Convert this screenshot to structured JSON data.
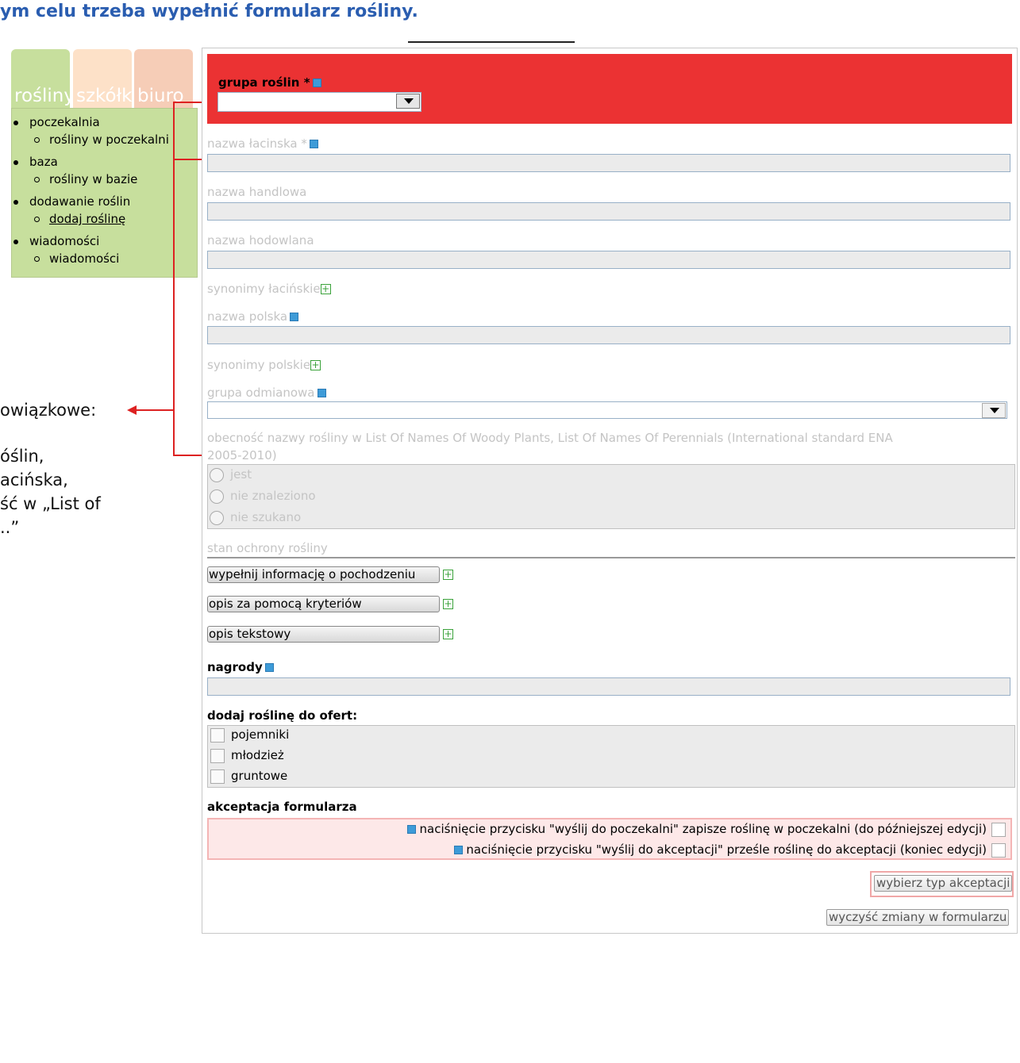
{
  "heading": "ym celu trzeba wypełnić formularz rośliny.",
  "tabs": [
    "rośliny",
    "szkółki",
    "biuro"
  ],
  "menu": [
    {
      "label": "poczekalnia",
      "sub": "rośliny w poczekalni"
    },
    {
      "label": "baza",
      "sub": "rośliny w bazie"
    },
    {
      "label": "dodawanie roślin",
      "sub": "dodaj roślinę"
    },
    {
      "label": "wiadomości",
      "sub": "wiadomości"
    }
  ],
  "annotation": {
    "line1": "owiązkowe:",
    "line2": "óślin,",
    "line3": "acińska,",
    "line4": "ść w „List of",
    "line5": "..”"
  },
  "form": {
    "grupa_roslin": "grupa roślin",
    "required_mark": "*",
    "nazwa_lacinska": "nazwa łacinska",
    "nazwa_handlowa": "nazwa handlowa",
    "nazwa_hodowlana": "nazwa hodowlana",
    "synonimy_lacinskie": "synonimy łacińskie",
    "nazwa_polska": "nazwa polska",
    "synonimy_polskie": "synonimy polskie",
    "grupa_odmianowa": "grupa odmianowa",
    "obecnosc_line1": "obecność nazwy rośliny w List Of Names Of Woody Plants, List Of Names Of Perennials (International standard ENA",
    "obecnosc_line2": "2005-2010)",
    "radio_options": [
      "jest",
      "nie znaleziono",
      "nie szukano"
    ],
    "stan_ochrony": "stan ochrony rośliny",
    "btn_pochodzenie": "wypełnij informację o pochodzeniu",
    "btn_kryteria": "opis za pomocą kryteriów",
    "btn_tekstowy": "opis tekstowy",
    "nagrody": "nagrody",
    "oferty_title": "dodaj roślinę do ofert:",
    "oferty_options": [
      "pojemniki",
      "młodzież",
      "gruntowe"
    ],
    "akceptacja_title": "akceptacja formularza",
    "akceptacja_1": "naciśnięcie przycisku \"wyślij do poczekalni\" zapisze roślinę w poczekalni (do późniejszej edycji)",
    "akceptacja_2": "naciśnięcie przycisku \"wyślij do akceptacji\" prześle roślinę do akceptacji (koniec edycji)",
    "btn_wybierz": "wybierz typ akceptacji",
    "btn_wyczysc": "wyczyść zmiany w formularzu",
    "plus_glyph": "+"
  },
  "colors": {
    "heading": "#2a5db0",
    "menu_green": "#c7df9d",
    "required_red": "#eb3233",
    "label_grey": "#c4c4c4",
    "info_blue": "#3d9bd8",
    "plus_green": "#3aa23a",
    "connector_red": "#dd2222"
  }
}
